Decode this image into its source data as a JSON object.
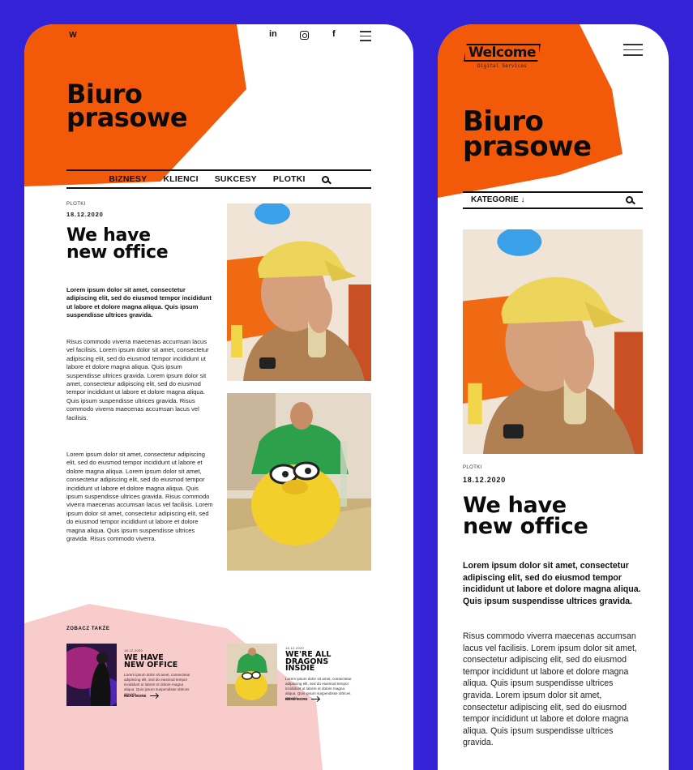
{
  "desktop": {
    "logo_letter": "W",
    "social": {
      "linkedin": "in",
      "facebook": "f"
    },
    "hero_title_line1": "Biuro",
    "hero_title_line2": "prasowe",
    "nav": [
      "BIZNESY",
      "KLIENCI",
      "SUKCESY",
      "PLOTKI"
    ],
    "article": {
      "category": "PLOTKI",
      "date": "18.12.2020",
      "title_line1": "We have",
      "title_line2": "new office",
      "lead": "Lorem ipsum dolor sit amet, consectetur adipiscing elit, sed do eiusmod tempor incididunt ut labore et dolore magna aliqua. Quis ipsum suspendisse ultrices gravida.",
      "paragraph1": "Risus commodo viverra maecenas accumsan lacus vel facilisis. Lorem ipsum dolor sit amet, consectetur adipiscing elit, sed do eiusmod tempor incididunt ut labore et dolore magna aliqua. Quis ipsum suspendisse ultrices gravida. Lorem ipsum dolor sit amet, consectetur adipiscing elit, sed do eiusmod tempor incididunt ut labore et dolore magna aliqua. Quis ipsum suspendisse ultrices gravida. Risus commodo viverra maecenas accumsan lacus vel facilisis.",
      "paragraph2": "Lorem ipsum dolor sit amet, consectetur adipiscing elit, sed do eiusmod tempor incididunt ut labore et dolore magna aliqua. Lorem ipsum dolor sit amet, consectetur adipiscing elit, sed do eiusmod tempor incididunt ut labore et dolore magna aliqua. Quis ipsum suspendisse ultrices gravida. Risus commodo viverra maecenas accumsan lacus vel facilisis. Lorem ipsum dolor sit amet, consectetur adipiscing elit, sed do eiusmod tempor incididunt ut labore et dolore magna aliqua. Quis ipsum suspendisse ultrices gravida. Risus commodo viverra."
    },
    "related": {
      "heading": "ZOBACZ TAKŻE",
      "items": [
        {
          "date": "18.12.2020",
          "title_line1": "WE HAVE",
          "title_line2": "NEW OFFICE",
          "title_line3": "",
          "excerpt": "Lorem ipsum dolor sit amet, consectetur adipiscing elit, sed do eiusmod tempor incididunt ut labore et dolore magna aliqua. Quis ipsum suspendisse ultrices gravida.",
          "more": "READ MORE"
        },
        {
          "date": "18.12.2020",
          "title_line1": "WE'RE ALL",
          "title_line2": "DRAGONS",
          "title_line3": "INSDIE",
          "excerpt": "Lorem ipsum dolor sit amet, consectetur adipiscing elit, sed do eiusmod tempor incididunt ut labore et dolore magna aliqua. Quis ipsum suspendisse ultrices gravida.",
          "more": "READ MORE"
        }
      ]
    }
  },
  "mobile": {
    "logo_text": "Welcome",
    "logo_sub": "Digital Services",
    "hero_title_line1": "Biuro",
    "hero_title_line2": "prasowe",
    "category_label": "KATEGORIE ↓",
    "article": {
      "category": "PLOTKI",
      "date": "18.12.2020",
      "title_line1": "We have",
      "title_line2": "new office",
      "lead": "Lorem ipsum dolor sit amet, consectetur adipiscing elit, sed do eiusmod tempor incididunt ut labore et dolore magna aliqua. Quis ipsum suspendisse ultrices gravida.",
      "paragraph1": "Risus commodo viverra maecenas accumsan lacus vel facilisis. Lorem ipsum dolor sit amet, consectetur adipiscing elit, sed do eiusmod tempor incididunt ut labore et dolore magna aliqua. Quis ipsum suspendisse ultrices gravida. Lorem ipsum dolor sit amet, consectetur adipiscing elit, sed do eiusmod tempor incididunt ut labore et dolore magna aliqua. Quis ipsum suspendisse ultrices gravida."
    }
  },
  "colors": {
    "background": "#3322d6",
    "accent_orange": "#f25a0a",
    "pink": "#f9cccc",
    "text": "#0b0b0b"
  },
  "icons": [
    "logo-w-icon",
    "linkedin-icon",
    "instagram-icon",
    "facebook-icon",
    "menu-icon",
    "search-icon",
    "arrow-right-icon"
  ]
}
